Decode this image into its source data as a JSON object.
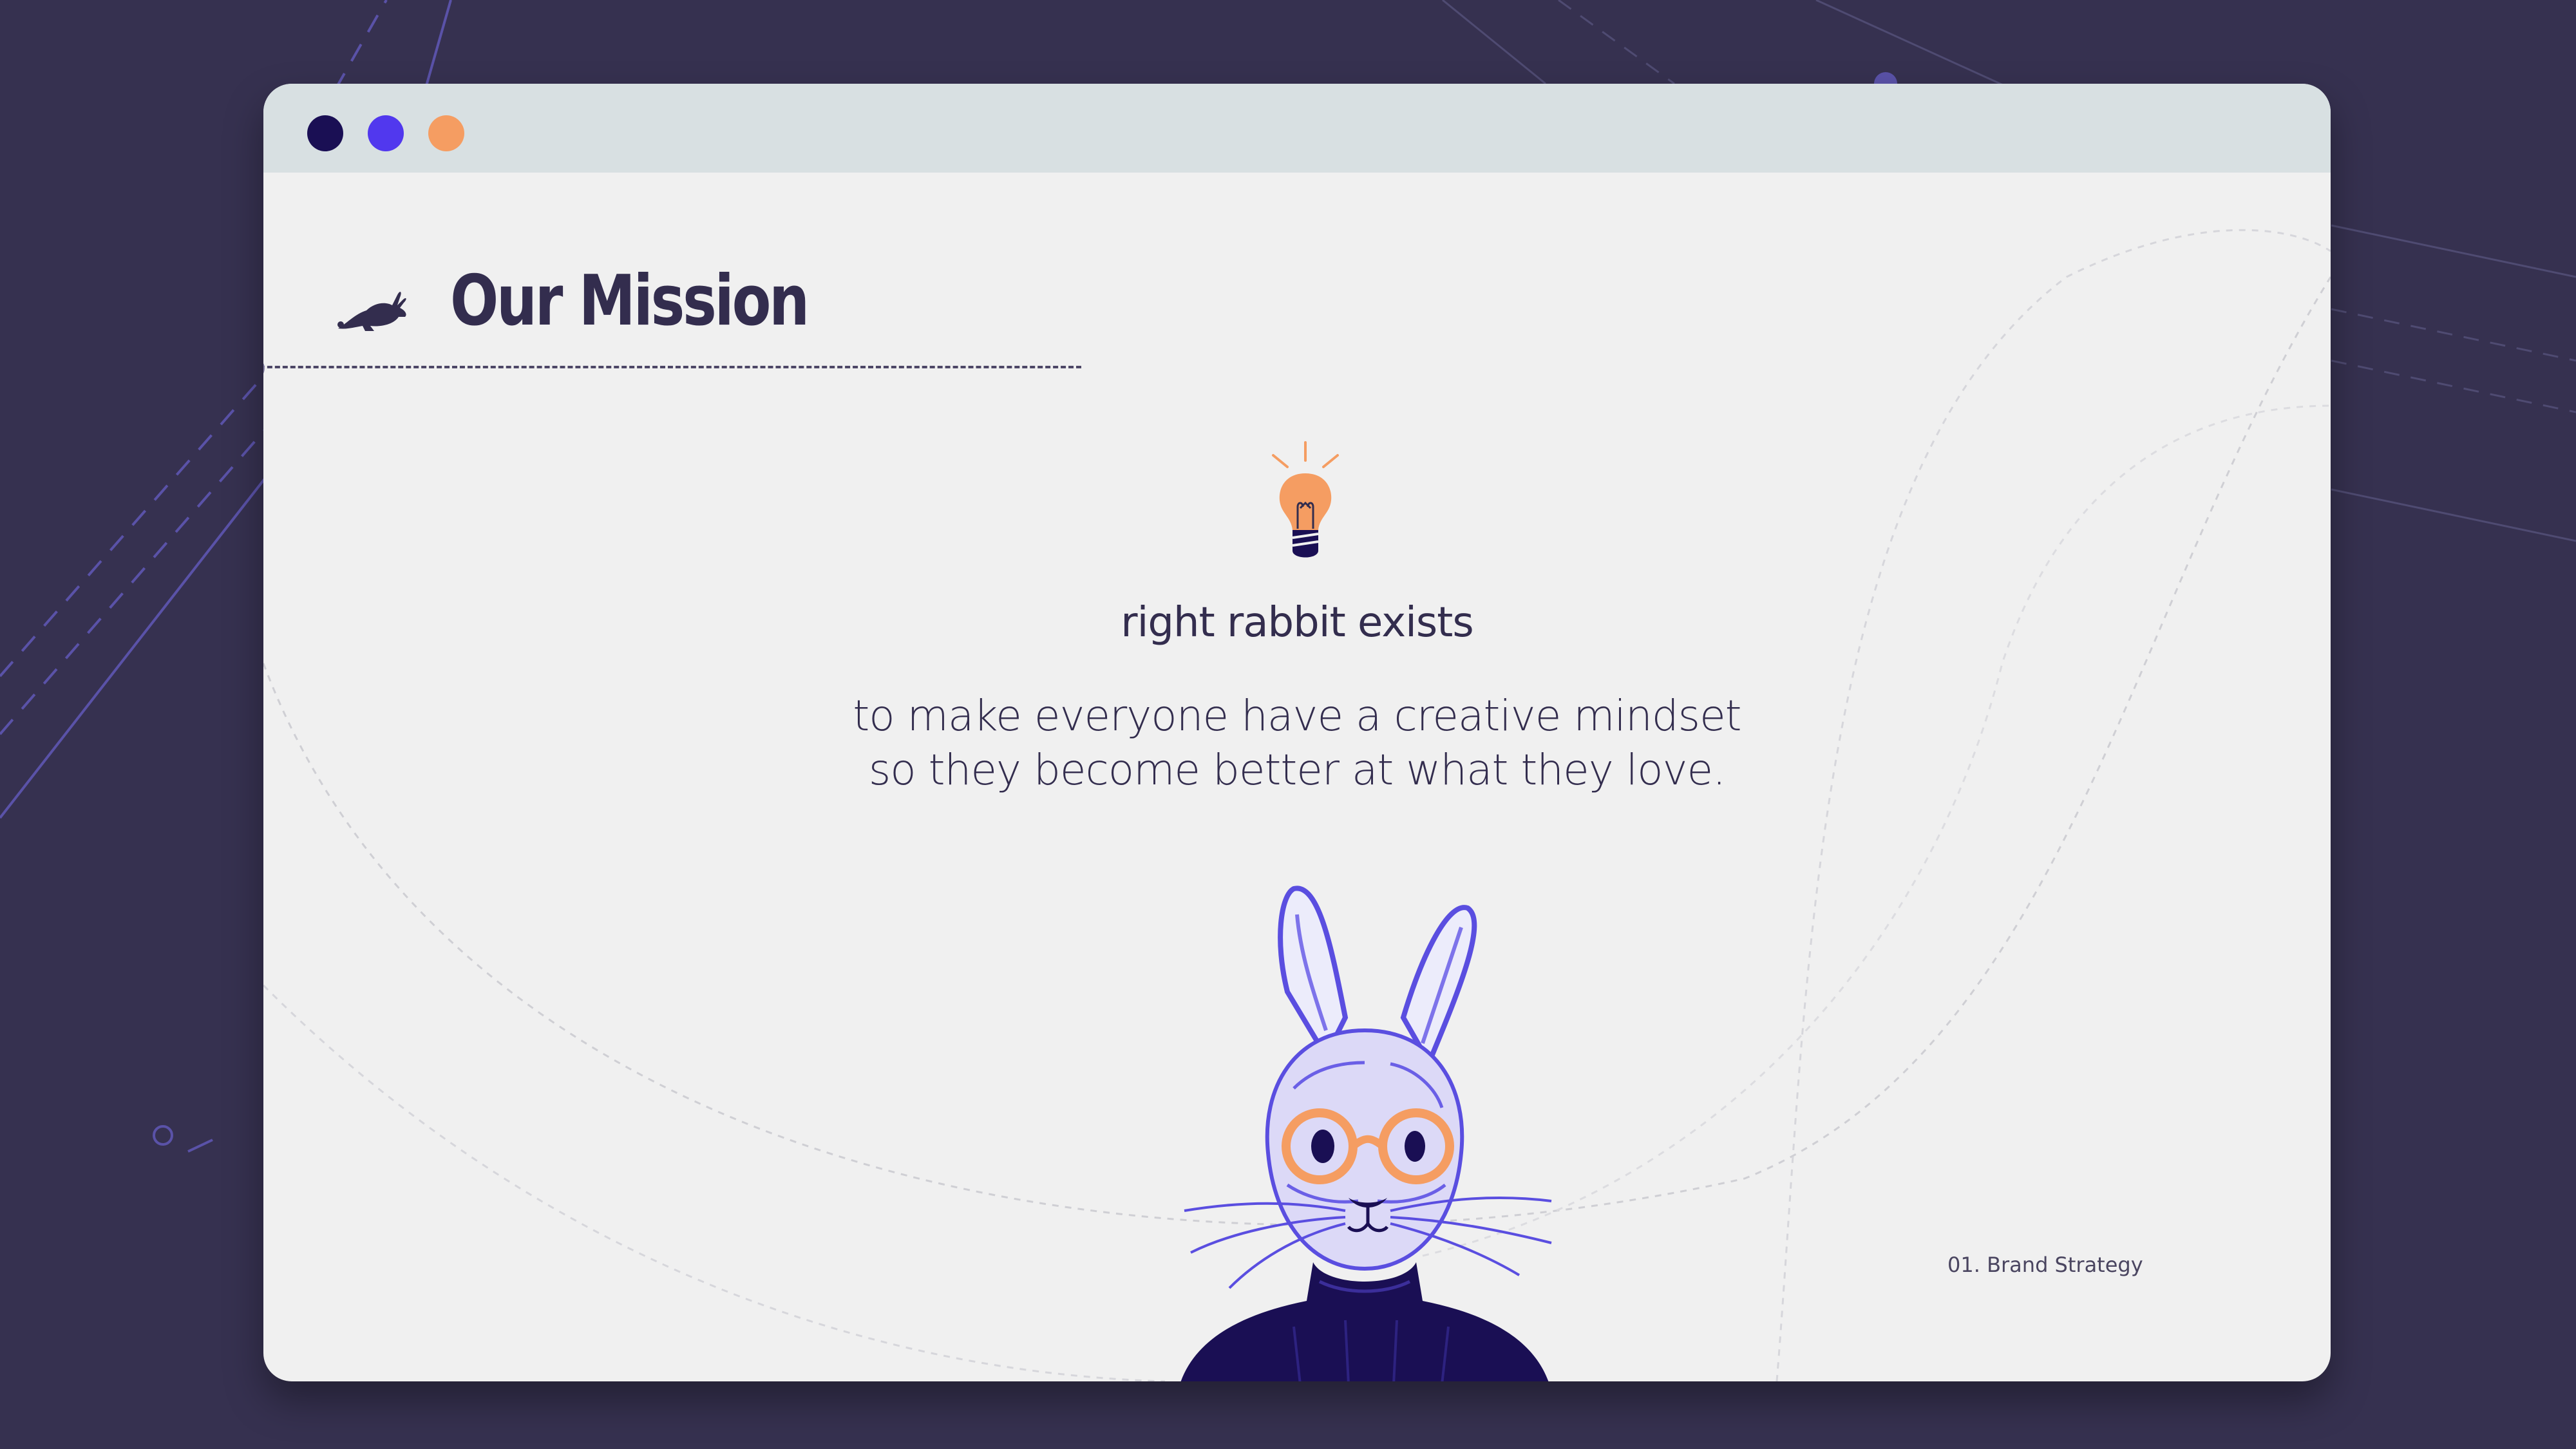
{
  "window": {
    "controls": [
      "window-dot-dark",
      "window-dot-violet",
      "window-dot-orange"
    ],
    "colors": {
      "dark": "#1a0f54",
      "violet": "#5138ee",
      "orange": "#f59d62"
    }
  },
  "header": {
    "icon": "rabbit-icon",
    "title": "Our Mission"
  },
  "content": {
    "icon": "lightbulb-icon",
    "subtitle": "right rabbit exists",
    "mission_lines": [
      "to make everyone have a creative mindset",
      "so they become better at what they love."
    ]
  },
  "illustration": {
    "icon": "rabbit-with-glasses-illustration"
  },
  "footer": {
    "label": "01. Brand Strategy"
  },
  "colors": {
    "background": "#363150",
    "card": "#f0f0f0",
    "text": "#332d4e",
    "accent": "#f59d62",
    "primary": "#5138ee"
  }
}
